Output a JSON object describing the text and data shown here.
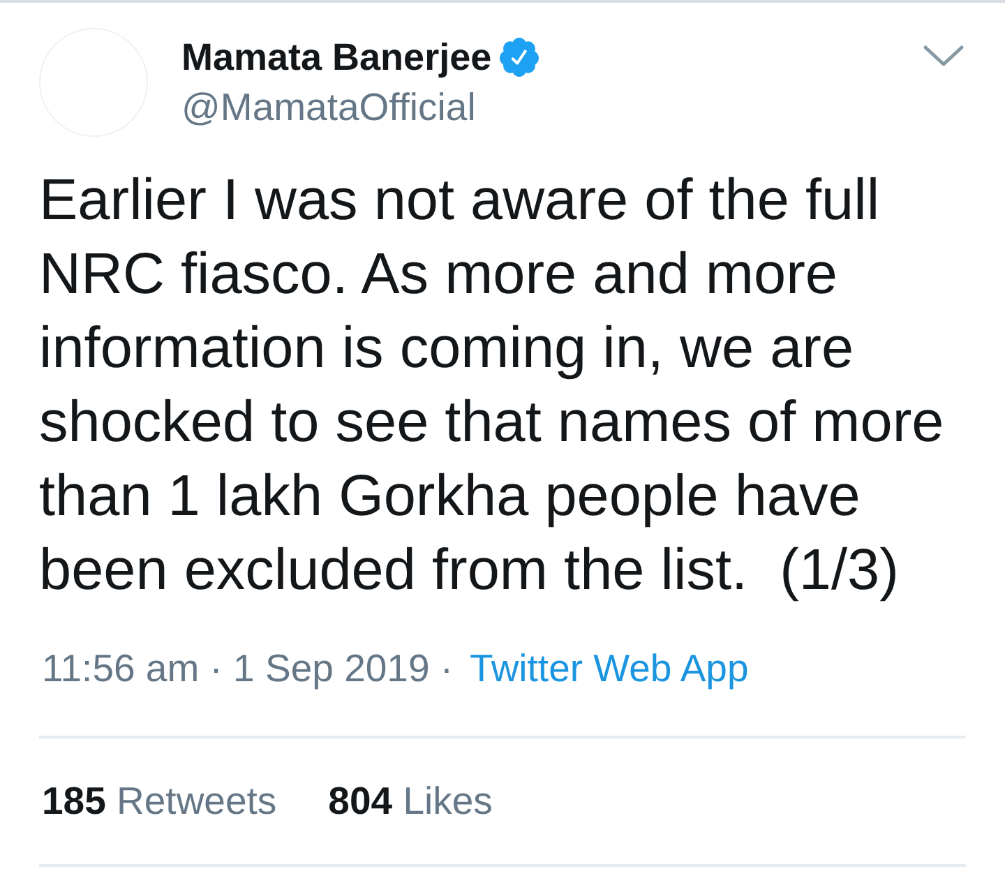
{
  "tweet": {
    "author": {
      "name": "Mamata Banerjee",
      "verified": true,
      "handle": "@MamataOfficial"
    },
    "text": "Earlier I was not aware of the full NRC fiasco. As more and more information is coming in, we are shocked to see that names of more than 1 lakh Gorkha people have been excluded from the list.  (1/3)",
    "timestamp": "11:56 am · 1 Sep 2019 ·",
    "source": "Twitter Web App",
    "stats": [
      "**185** Retweets",
      "**804** Likes"
    ]
  }
}
